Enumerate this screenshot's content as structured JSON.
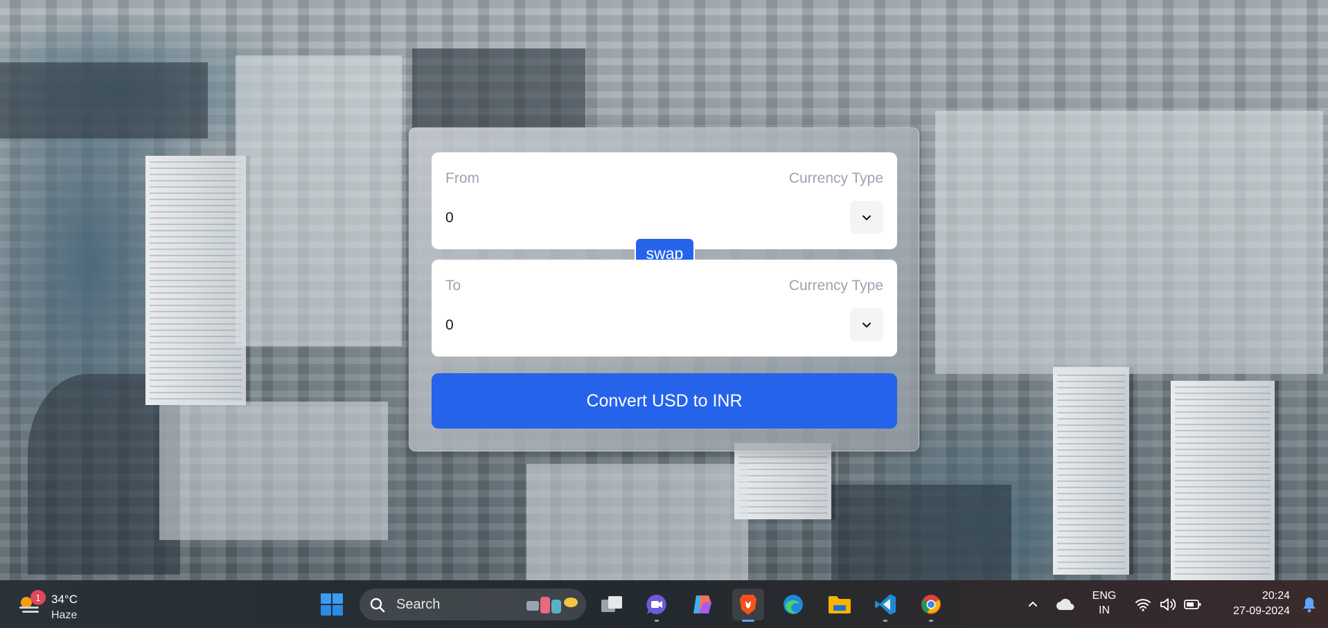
{
  "converter": {
    "from": {
      "label": "From",
      "currency_label": "Currency Type",
      "amount": "0"
    },
    "to": {
      "label": "To",
      "currency_label": "Currency Type",
      "amount": "0"
    },
    "swap_label": "swap",
    "convert_label": "Convert USD to INR",
    "accent_color": "#2563eb"
  },
  "taskbar": {
    "weather": {
      "notification_count": "1",
      "temperature": "34°C",
      "condition": "Haze",
      "icon": "weather-haze-icon"
    },
    "start_icon": "windows-start-icon",
    "search": {
      "placeholder": "Search"
    },
    "apps": [
      {
        "name": "task-view-icon"
      },
      {
        "name": "meet-icon"
      },
      {
        "name": "copilot-icon"
      },
      {
        "name": "brave-browser-icon",
        "active": true
      },
      {
        "name": "edge-browser-icon"
      },
      {
        "name": "file-explorer-icon"
      },
      {
        "name": "vscode-icon"
      },
      {
        "name": "chrome-browser-icon"
      }
    ],
    "tray": {
      "language_top": "ENG",
      "language_bottom": "IN",
      "time": "20:24",
      "date": "27-09-2024"
    }
  }
}
